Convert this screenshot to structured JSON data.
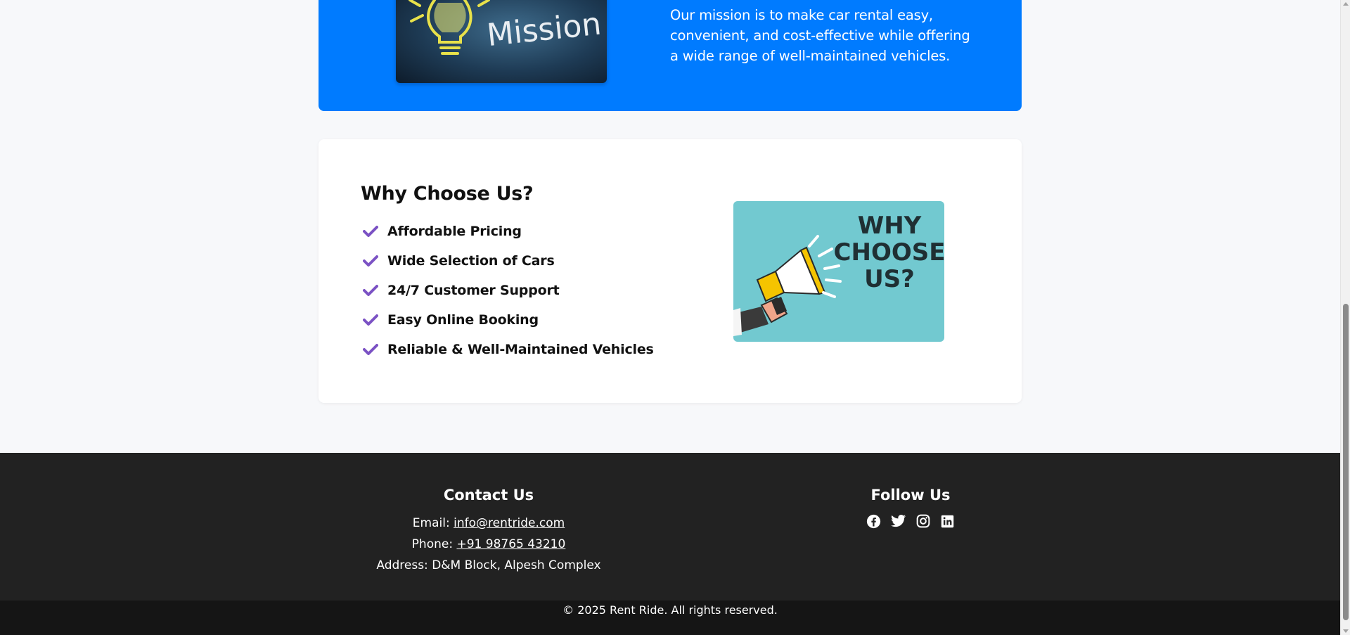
{
  "mission": {
    "image_text": "Mission",
    "text": "Our mission is to make car rental easy, convenient, and cost-effective while offering a wide range of well-maintained vehicles."
  },
  "why_choose": {
    "title": "Why Choose Us?",
    "items": [
      {
        "label": "Affordable Pricing",
        "icon": "check-icon"
      },
      {
        "label": "Wide Selection of Cars",
        "icon": "check-icon"
      },
      {
        "label": "24/7 Customer Support",
        "icon": "check-icon"
      },
      {
        "label": "Easy Online Booking",
        "icon": "check-icon"
      },
      {
        "label": "Reliable & Well-Maintained Vehicles",
        "icon": "check-icon"
      }
    ],
    "image_text": [
      "WHY",
      "CHOOSE",
      "US?"
    ]
  },
  "footer": {
    "contact": {
      "heading": "Contact Us",
      "email_label": "Email:",
      "email": "info@rentride.com",
      "phone_label": "Phone:",
      "phone": "+91 98765 43210",
      "address_label": "Address:",
      "address": "D&M Block, Alpesh Complex"
    },
    "follow": {
      "heading": "Follow Us",
      "icons": [
        "facebook-icon",
        "twitter-icon",
        "instagram-icon",
        "linkedin-icon"
      ]
    },
    "copyright": "© 2025 Rent Ride. All rights reserved."
  },
  "colors": {
    "accent": "#007bff",
    "check": "#7b52c4",
    "footer_bg": "#222222",
    "bottom_bar_bg": "#151515",
    "page_bg": "#f7f8fa"
  }
}
